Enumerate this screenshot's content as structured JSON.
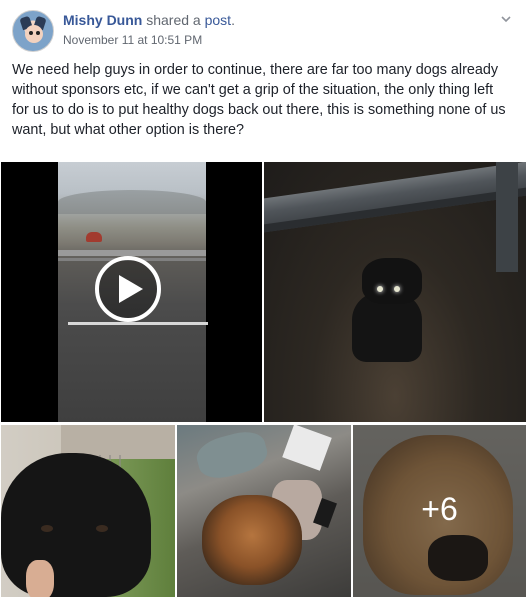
{
  "post": {
    "author": "Mishy Dunn",
    "action": "shared a",
    "object": "post",
    "suffix": ".",
    "timestamp": "November 11 at 10:51 PM",
    "body": "We need help guys in order to continue, there are far too many dogs already without sponsors etc, if we can't get a grip of the situation, the only thing left for us to do is to put healthy dogs back out there, this is something none of us want, but what other option is there?"
  },
  "media": {
    "more_count": "+6",
    "icons": [
      "chevron-down-icon",
      "play-icon"
    ]
  },
  "colors": {
    "link": "#385898",
    "meta": "#616770",
    "text": "#1d2129"
  }
}
